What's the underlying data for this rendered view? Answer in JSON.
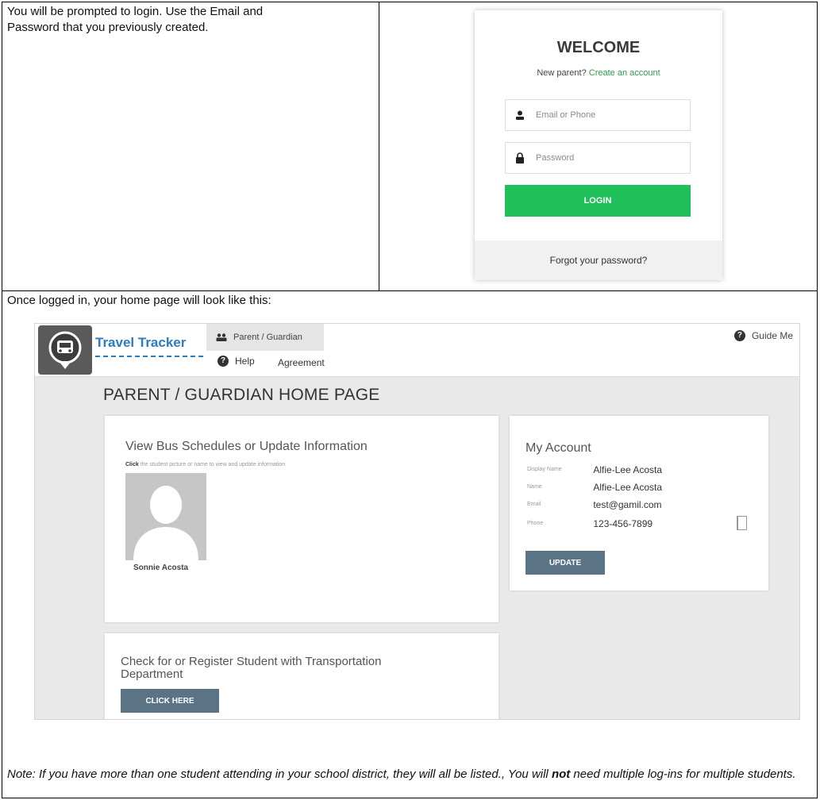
{
  "instructions": {
    "intro_line1": "You will be prompted to login. Use the Email and",
    "intro_line2": "Password that you previously created.",
    "logged_in_text": "Once logged in, your home page will look like this:",
    "note_pre": "Note: If you have more than one student attending in your school district, they will all be listed., You will ",
    "note_bold": "not",
    "note_post": " need multiple log-ins for multiple students."
  },
  "login": {
    "title": "WELCOME",
    "new_parent": "New parent?",
    "create_account": "Create an account",
    "email_placeholder": "Email or Phone",
    "password_placeholder": "Password",
    "login_button": "LOGIN",
    "forgot": "Forgot your password?",
    "accent_color": "#1fbf5a"
  },
  "app": {
    "logo_text": "Travel Tracker",
    "tab_parent": "Parent / Guardian",
    "guide_me": "Guide Me",
    "nav_help": "Help",
    "nav_agreement": "Agreement",
    "page_title": "PARENT / GUARDIAN HOME PAGE",
    "schedules": {
      "title": "View Bus Schedules or Update Information",
      "hint_bold": "Click",
      "hint_rest": "the student picture or name to view and update information",
      "student_name": "Sonnie Acosta"
    },
    "account": {
      "title": "My Account",
      "rows": [
        {
          "label": "Display Name",
          "value": "Alfie-Lee Acosta"
        },
        {
          "label": "Name",
          "value": "Alfie-Lee Acosta"
        },
        {
          "label": "Email",
          "value": "test@gamil.com"
        },
        {
          "label": "Phone",
          "value": "123-456-7899"
        }
      ],
      "update_button": "UPDATE"
    },
    "register": {
      "title": "Check for or Register Student with Transportation Department",
      "button": "CLICK HERE"
    },
    "button_color": "#5a7486"
  }
}
